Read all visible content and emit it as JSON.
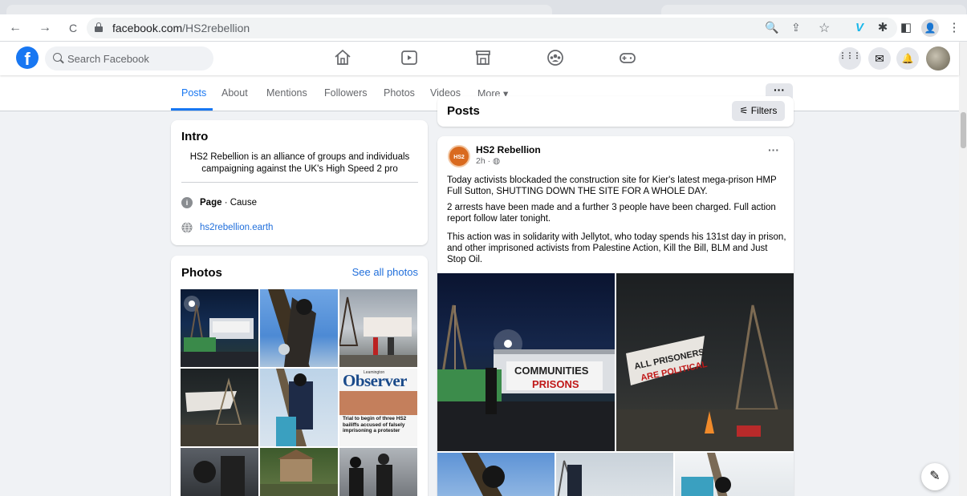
{
  "browser": {
    "url_host": "facebook.com",
    "url_path": "/HS2rebellion",
    "back_glyph": "←",
    "forward_glyph": "→",
    "reload_glyph": "C",
    "zoom_glyph": "🔍",
    "share_glyph": "⇪",
    "bookmark_glyph": "☆",
    "ext_v_glyph": "V",
    "ext_puzzle_glyph": "✱",
    "sidepanel_glyph": "◧",
    "profile_glyph": "👤",
    "menu_glyph": "⋮"
  },
  "fb": {
    "logo": "f",
    "search_placeholder": "Search Facebook",
    "menu_glyph": "⋮⋮⋮",
    "messenger_glyph": "✉",
    "notify_glyph": "🔔"
  },
  "page_tabs": {
    "items": [
      "Posts",
      "About",
      "Mentions",
      "Followers",
      "Photos",
      "Videos"
    ],
    "more": "More ▾",
    "dots": "···"
  },
  "intro": {
    "title": "Intro",
    "bio": "HS2 Rebellion is an alliance of groups and individuals campaigning against the UK's High Speed 2 pro",
    "category_bold": "Page",
    "category_rest": " · Cause",
    "website": "hs2rebellion.earth",
    "info_glyph": "i"
  },
  "photos": {
    "title": "Photos",
    "see_all": "See all photos",
    "observer_masthead_small": "Leamington",
    "observer_masthead": "Observer",
    "observer_headline": "Trial to begin of three HS2 bailiffs accused of falsely imprisoning a protester"
  },
  "posts": {
    "title": "Posts",
    "filters_glyph": "⚟",
    "filters": "Filters"
  },
  "post": {
    "author": "HS2 Rebellion",
    "avatar_text": "HS2",
    "time": "2h · ",
    "globe_glyph": "◍",
    "more_glyph": "···",
    "p1": "Today activists blockaded the construction site for Kier's latest mega-prison HMP Full Sutton, SHUTTING DOWN THE SITE FOR A WHOLE DAY.",
    "p2": "2 arrests have been made and a further 3 people have been charged. Full action report follow later tonight.",
    "p3": "This action was in solidarity with Jellytot, who today spends his 131st day in prison, and other imprisoned activists from Palestine Action, Kill the Bill, BLM and Just Stop Oil.",
    "banner1_text": "COMMUNITIES PRISONS",
    "banner2_text": "ALL PRISONERS ARE POLITICAL"
  },
  "compose_glyph": "✎",
  "colors": {
    "fb_blue": "#1877f2",
    "link_blue": "#216fdb",
    "page_bg": "#f0f2f5"
  }
}
